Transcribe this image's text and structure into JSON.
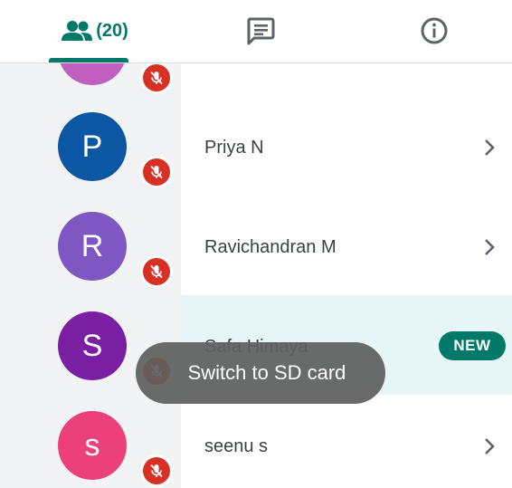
{
  "tabs": {
    "people_count": "(20)",
    "icons": [
      "people-icon",
      "chat-icon",
      "info-icon"
    ]
  },
  "participants": [
    {
      "name": "",
      "initial": "",
      "avatar_color": "#c05fbd",
      "muted": true
    },
    {
      "name": "Priya N",
      "initial": "P",
      "avatar_color": "#0b57a3",
      "muted": true
    },
    {
      "name": "Ravichandran M",
      "initial": "R",
      "avatar_color": "#7e57c2",
      "muted": true
    },
    {
      "name": "Safa Himaya",
      "initial": "S",
      "avatar_color": "#7b1fa2",
      "muted": true,
      "badge": "NEW"
    },
    {
      "name": "seenu s",
      "initial": "s",
      "avatar_color": "#ec407a",
      "muted": true
    }
  ],
  "toast": {
    "message": "Switch to SD card"
  },
  "colors": {
    "accent": "#00796b",
    "muted_red": "#d93025",
    "highlight_row": "#e6f6f6",
    "gutter": "#f1f3f4"
  }
}
